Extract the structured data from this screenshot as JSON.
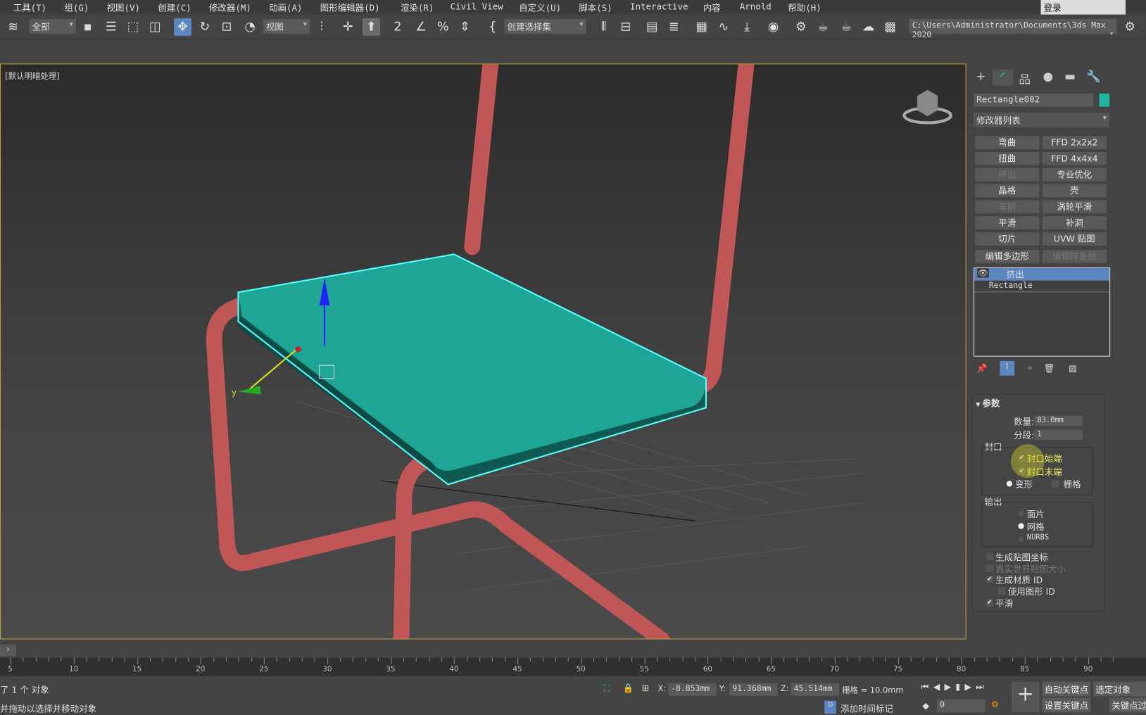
{
  "menu": [
    "工具(T)",
    "组(G)",
    "视图(V)",
    "创建(C)",
    "修改器(M)",
    "动画(A)",
    "图形编辑器(D)",
    "渲染(R)",
    "Civil View",
    "自定义(U)",
    "脚本(S)",
    "Interactive",
    "内容",
    "Arnold",
    "帮助(H)"
  ],
  "login": "登录",
  "toolbar": {
    "selection_filter": "全部",
    "reference_coord": "视图",
    "named_selection": "创建选择集",
    "project_path": "C:\\Users\\Administrator\\Documents\\3ds Max 2020"
  },
  "viewport": {
    "label": "[默认明暗处理]",
    "axis_y": "y",
    "seat_color": "#1fa595",
    "tube_color": "#c05656",
    "selection_color": "#5ff"
  },
  "panel": {
    "object_name": "Rectangle002",
    "object_color": "#1fb5a0",
    "modifier_list": "修改器列表",
    "modifiers": [
      {
        "l": "弯曲",
        "d": false
      },
      {
        "l": "FFD 2x2x2",
        "d": false
      },
      {
        "l": "扭曲",
        "d": false
      },
      {
        "l": "FFD 4x4x4",
        "d": false
      },
      {
        "l": "挤出",
        "d": true
      },
      {
        "l": "专业优化",
        "d": false
      },
      {
        "l": "晶格",
        "d": false
      },
      {
        "l": "壳",
        "d": false
      },
      {
        "l": "车削",
        "d": true
      },
      {
        "l": "涡轮平滑",
        "d": false
      },
      {
        "l": "平滑",
        "d": false
      },
      {
        "l": "补洞",
        "d": false
      },
      {
        "l": "切片",
        "d": false
      },
      {
        "l": "UVW 贴图",
        "d": false
      },
      {
        "l": "编辑多边形",
        "d": false
      },
      {
        "l": "编辑样条线",
        "d": true
      }
    ],
    "stack": [
      "挤出",
      "Rectangle"
    ],
    "params": {
      "title": "参数",
      "amount_label": "数量:",
      "amount": "83.0mm",
      "segments_label": "分段:",
      "segments": "1",
      "capping_label": "封口",
      "cap_start": "封口始端",
      "cap_end": "封口末端",
      "morph": "变形",
      "grid": "栅格",
      "output_label": "输出",
      "patch": "面片",
      "mesh": "网格",
      "nurbs": "NURBS",
      "gen_map": "生成贴图坐标",
      "real_world": "真实世界贴图大小",
      "gen_mat": "生成材质 ID",
      "use_shape": "使用图形 ID",
      "smooth": "平滑"
    }
  },
  "timeline": {
    "ticks": [
      "5",
      "10",
      "15",
      "20",
      "25",
      "30",
      "35",
      "40",
      "45",
      "50",
      "55",
      "60",
      "65",
      "70",
      "75",
      "80",
      "85",
      "90"
    ]
  },
  "status": {
    "selected": "了 1 个 对象",
    "prompt": "并拖动以选择并移动对象",
    "x_label": "X:",
    "x": "-8.853mm",
    "y_label": "Y:",
    "y": "91.368mm",
    "z_label": "Z:",
    "z": "45.514mm",
    "grid": "栅格 = 10.0mm",
    "add_tag": "添加时间标记",
    "frame": "0",
    "auto_key": "自动关键点",
    "selected_obj": "选定对象",
    "set_key": "设置关键点",
    "key_filter": "关键点过滤器"
  }
}
